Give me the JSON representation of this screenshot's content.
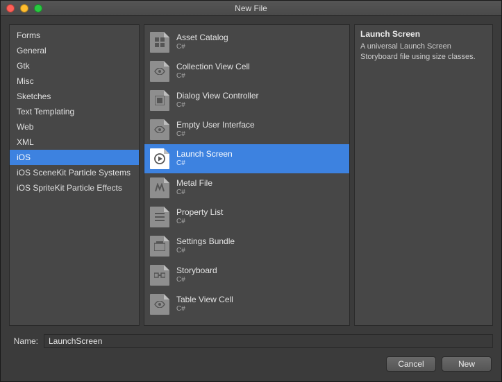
{
  "window": {
    "title": "New File"
  },
  "sidebar": {
    "items": [
      {
        "label": "Forms"
      },
      {
        "label": "General"
      },
      {
        "label": "Gtk"
      },
      {
        "label": "Misc"
      },
      {
        "label": "Sketches"
      },
      {
        "label": "Text Templating"
      },
      {
        "label": "Web"
      },
      {
        "label": "XML"
      },
      {
        "label": "iOS"
      },
      {
        "label": "iOS SceneKit Particle Systems"
      },
      {
        "label": "iOS SpriteKit Particle Effects"
      }
    ],
    "selected_index": 8
  },
  "templates": {
    "sub": "C#",
    "items": [
      {
        "label": "Asset Catalog",
        "icon": "grid-icon"
      },
      {
        "label": "Collection View Cell",
        "icon": "eye-icon"
      },
      {
        "label": "Dialog View Controller",
        "icon": "swatch-icon"
      },
      {
        "label": "Empty User Interface",
        "icon": "eye-icon"
      },
      {
        "label": "Launch Screen",
        "icon": "play-icon"
      },
      {
        "label": "Metal File",
        "icon": "metal-icon"
      },
      {
        "label": "Property List",
        "icon": "list-icon"
      },
      {
        "label": "Settings Bundle",
        "icon": "bundle-icon"
      },
      {
        "label": "Storyboard",
        "icon": "storyboard-icon"
      },
      {
        "label": "Table View Cell",
        "icon": "eye-icon"
      }
    ],
    "selected_index": 4
  },
  "details": {
    "title": "Launch Screen",
    "description": "A universal Launch Screen Storyboard file using size classes."
  },
  "name_field": {
    "label": "Name:",
    "value": "LaunchScreen"
  },
  "buttons": {
    "cancel": "Cancel",
    "new": "New"
  },
  "colors": {
    "accent": "#3d82e0",
    "panel": "#474747",
    "bg": "#3b3b3b"
  }
}
